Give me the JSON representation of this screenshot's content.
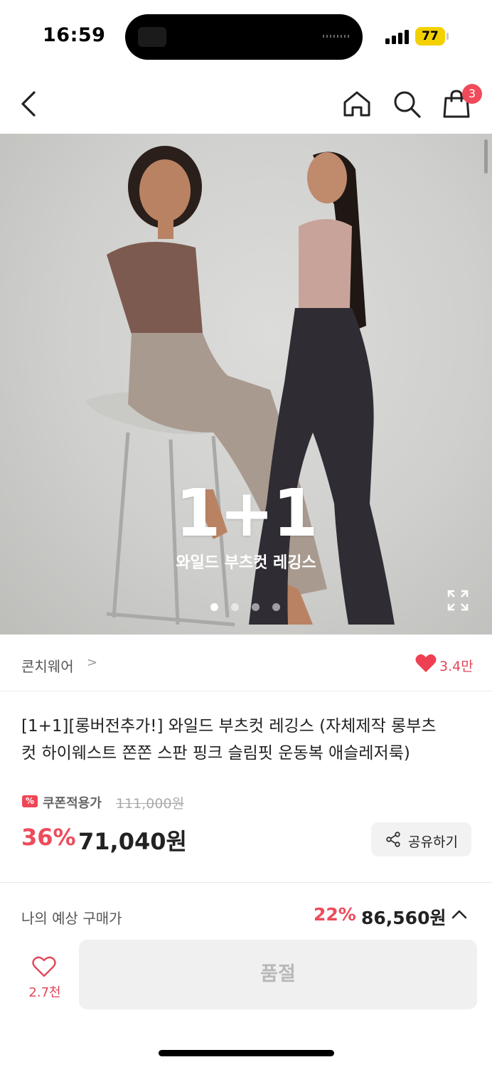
{
  "status": {
    "time": "16:59",
    "battery": "77"
  },
  "nav": {
    "cart_count": "3"
  },
  "hero": {
    "promo_big": "1+1",
    "promo_sub": "와일드 부츠컷 레깅스",
    "slide_count": 4,
    "active_slide": 1
  },
  "brand": {
    "name": "콘치웨어",
    "chevron": ">",
    "like_count": "3.4만"
  },
  "product": {
    "title": "[1+1][롱버전추가!] 와일드 부츠컷 레깅스 (자체제작 롱부츠컷 하이웨스트 쫀쫀 스판 핑크 슬림핏 운동복 애슬레저룩)",
    "coupon_icon": "%",
    "coupon_label": "쿠폰적용가",
    "original_price": "111,000원",
    "discount": "36%",
    "price": "71,040원",
    "share_label": "공유하기"
  },
  "bottom": {
    "est_label": "나의 예상 구매가",
    "est_discount": "22%",
    "est_price": "86,560원",
    "wish_count": "2.7천",
    "buy_label": "품절"
  },
  "colors": {
    "accent": "#ee4b5b",
    "badge": "#f04b5a",
    "battery": "#f3d100"
  }
}
